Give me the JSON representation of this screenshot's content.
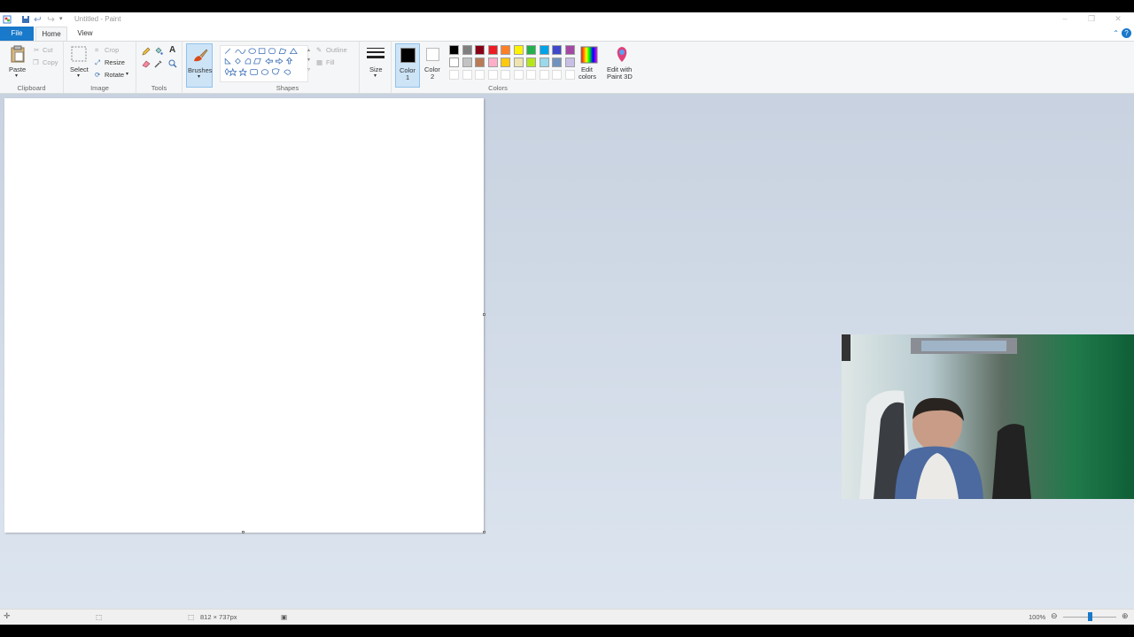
{
  "window": {
    "title": "Untitled - Paint",
    "controls": {
      "minimize": "–",
      "maximize": "❐",
      "close": "✕"
    }
  },
  "tabs": [
    {
      "label": "File"
    },
    {
      "label": "Home"
    },
    {
      "label": "View"
    }
  ],
  "help_label": "?",
  "ribbon": {
    "clipboard": {
      "paste": "Paste",
      "cut": "Cut",
      "copy": "Copy",
      "group": "Clipboard"
    },
    "image": {
      "select": "Select",
      "crop": "Crop",
      "resize": "Resize",
      "rotate": "Rotate",
      "group": "Image"
    },
    "tools": {
      "group": "Tools"
    },
    "brushes": {
      "label": "Brushes"
    },
    "shapes": {
      "outline": "Outline",
      "fill": "Fill",
      "group": "Shapes"
    },
    "size": {
      "label": "Size"
    },
    "color1": {
      "label": "Color",
      "num": "1",
      "value": "#000000"
    },
    "color2": {
      "label": "Color",
      "num": "2",
      "value": "#ffffff"
    },
    "colors": {
      "group": "Colors",
      "row1": [
        "#000000",
        "#7f7f7f",
        "#880015",
        "#ed1c24",
        "#ff7f27",
        "#fff200",
        "#22b14c",
        "#00a2e8",
        "#3f48cc",
        "#a349a4"
      ],
      "row2": [
        "#ffffff",
        "#c3c3c3",
        "#b97a57",
        "#ffaec9",
        "#ffc90e",
        "#efe4b0",
        "#b5e61d",
        "#99d9ea",
        "#7092be",
        "#c8bfe7"
      ]
    },
    "edit_colors": {
      "line1": "Edit",
      "line2": "colors"
    },
    "paint3d": {
      "line1": "Edit with",
      "line2": "Paint 3D"
    }
  },
  "status": {
    "canvas_size": "812 × 737px",
    "zoom": "100%"
  }
}
